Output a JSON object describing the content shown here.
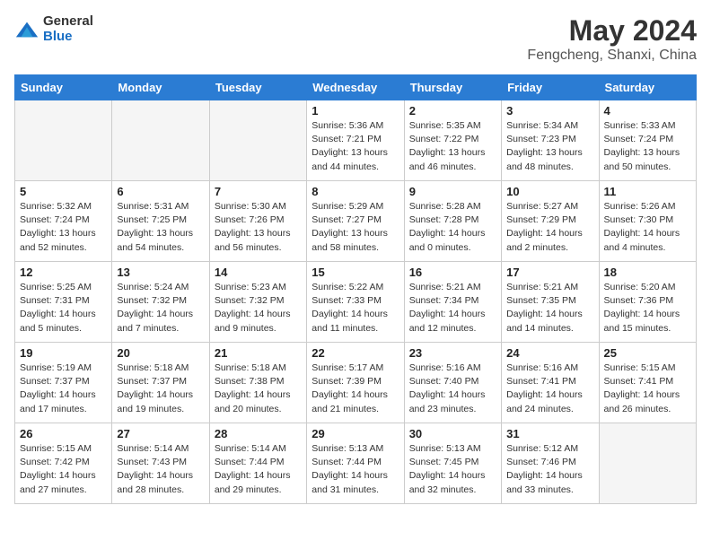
{
  "header": {
    "logo_general": "General",
    "logo_blue": "Blue",
    "title": "May 2024",
    "subtitle": "Fengcheng, Shanxi, China"
  },
  "weekdays": [
    "Sunday",
    "Monday",
    "Tuesday",
    "Wednesday",
    "Thursday",
    "Friday",
    "Saturday"
  ],
  "weeks": [
    [
      {
        "day": "",
        "info": ""
      },
      {
        "day": "",
        "info": ""
      },
      {
        "day": "",
        "info": ""
      },
      {
        "day": "1",
        "info": "Sunrise: 5:36 AM\nSunset: 7:21 PM\nDaylight: 13 hours\nand 44 minutes."
      },
      {
        "day": "2",
        "info": "Sunrise: 5:35 AM\nSunset: 7:22 PM\nDaylight: 13 hours\nand 46 minutes."
      },
      {
        "day": "3",
        "info": "Sunrise: 5:34 AM\nSunset: 7:23 PM\nDaylight: 13 hours\nand 48 minutes."
      },
      {
        "day": "4",
        "info": "Sunrise: 5:33 AM\nSunset: 7:24 PM\nDaylight: 13 hours\nand 50 minutes."
      }
    ],
    [
      {
        "day": "5",
        "info": "Sunrise: 5:32 AM\nSunset: 7:24 PM\nDaylight: 13 hours\nand 52 minutes."
      },
      {
        "day": "6",
        "info": "Sunrise: 5:31 AM\nSunset: 7:25 PM\nDaylight: 13 hours\nand 54 minutes."
      },
      {
        "day": "7",
        "info": "Sunrise: 5:30 AM\nSunset: 7:26 PM\nDaylight: 13 hours\nand 56 minutes."
      },
      {
        "day": "8",
        "info": "Sunrise: 5:29 AM\nSunset: 7:27 PM\nDaylight: 13 hours\nand 58 minutes."
      },
      {
        "day": "9",
        "info": "Sunrise: 5:28 AM\nSunset: 7:28 PM\nDaylight: 14 hours\nand 0 minutes."
      },
      {
        "day": "10",
        "info": "Sunrise: 5:27 AM\nSunset: 7:29 PM\nDaylight: 14 hours\nand 2 minutes."
      },
      {
        "day": "11",
        "info": "Sunrise: 5:26 AM\nSunset: 7:30 PM\nDaylight: 14 hours\nand 4 minutes."
      }
    ],
    [
      {
        "day": "12",
        "info": "Sunrise: 5:25 AM\nSunset: 7:31 PM\nDaylight: 14 hours\nand 5 minutes."
      },
      {
        "day": "13",
        "info": "Sunrise: 5:24 AM\nSunset: 7:32 PM\nDaylight: 14 hours\nand 7 minutes."
      },
      {
        "day": "14",
        "info": "Sunrise: 5:23 AM\nSunset: 7:32 PM\nDaylight: 14 hours\nand 9 minutes."
      },
      {
        "day": "15",
        "info": "Sunrise: 5:22 AM\nSunset: 7:33 PM\nDaylight: 14 hours\nand 11 minutes."
      },
      {
        "day": "16",
        "info": "Sunrise: 5:21 AM\nSunset: 7:34 PM\nDaylight: 14 hours\nand 12 minutes."
      },
      {
        "day": "17",
        "info": "Sunrise: 5:21 AM\nSunset: 7:35 PM\nDaylight: 14 hours\nand 14 minutes."
      },
      {
        "day": "18",
        "info": "Sunrise: 5:20 AM\nSunset: 7:36 PM\nDaylight: 14 hours\nand 15 minutes."
      }
    ],
    [
      {
        "day": "19",
        "info": "Sunrise: 5:19 AM\nSunset: 7:37 PM\nDaylight: 14 hours\nand 17 minutes."
      },
      {
        "day": "20",
        "info": "Sunrise: 5:18 AM\nSunset: 7:37 PM\nDaylight: 14 hours\nand 19 minutes."
      },
      {
        "day": "21",
        "info": "Sunrise: 5:18 AM\nSunset: 7:38 PM\nDaylight: 14 hours\nand 20 minutes."
      },
      {
        "day": "22",
        "info": "Sunrise: 5:17 AM\nSunset: 7:39 PM\nDaylight: 14 hours\nand 21 minutes."
      },
      {
        "day": "23",
        "info": "Sunrise: 5:16 AM\nSunset: 7:40 PM\nDaylight: 14 hours\nand 23 minutes."
      },
      {
        "day": "24",
        "info": "Sunrise: 5:16 AM\nSunset: 7:41 PM\nDaylight: 14 hours\nand 24 minutes."
      },
      {
        "day": "25",
        "info": "Sunrise: 5:15 AM\nSunset: 7:41 PM\nDaylight: 14 hours\nand 26 minutes."
      }
    ],
    [
      {
        "day": "26",
        "info": "Sunrise: 5:15 AM\nSunset: 7:42 PM\nDaylight: 14 hours\nand 27 minutes."
      },
      {
        "day": "27",
        "info": "Sunrise: 5:14 AM\nSunset: 7:43 PM\nDaylight: 14 hours\nand 28 minutes."
      },
      {
        "day": "28",
        "info": "Sunrise: 5:14 AM\nSunset: 7:44 PM\nDaylight: 14 hours\nand 29 minutes."
      },
      {
        "day": "29",
        "info": "Sunrise: 5:13 AM\nSunset: 7:44 PM\nDaylight: 14 hours\nand 31 minutes."
      },
      {
        "day": "30",
        "info": "Sunrise: 5:13 AM\nSunset: 7:45 PM\nDaylight: 14 hours\nand 32 minutes."
      },
      {
        "day": "31",
        "info": "Sunrise: 5:12 AM\nSunset: 7:46 PM\nDaylight: 14 hours\nand 33 minutes."
      },
      {
        "day": "",
        "info": ""
      }
    ]
  ]
}
